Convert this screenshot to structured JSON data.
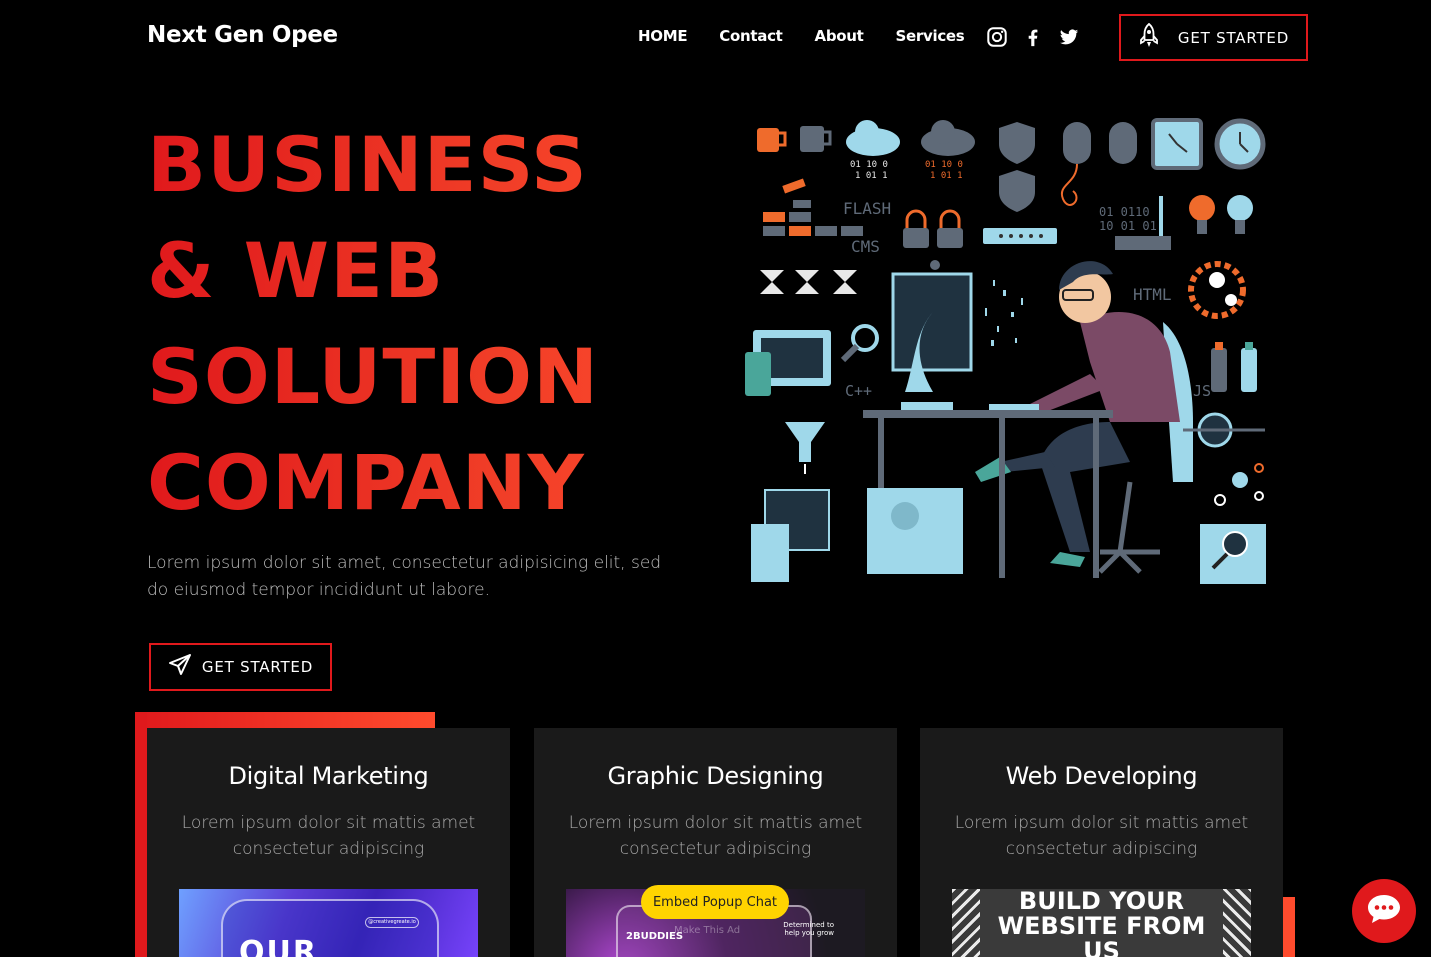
{
  "header": {
    "brand": "Next Gen Opee",
    "nav": [
      "HOME",
      "Contact",
      "About",
      "Services"
    ],
    "socials": [
      "instagram-icon",
      "facebook-icon",
      "twitter-icon"
    ],
    "cta": "GET STARTED"
  },
  "hero": {
    "title_lines": [
      "BUSINESS",
      "& WEB",
      "SOLUTION",
      "COMPANY"
    ],
    "description": "Lorem ipsum dolor sit amet, consectetur adipisicing elit, sed do eiusmod tempor incididunt ut labore.",
    "cta": "GET STARTED",
    "illustration_labels": {
      "flash": "FLASH",
      "cms": "CMS",
      "html": "HTML",
      "cpp": "C++",
      "js": "JS"
    }
  },
  "services": [
    {
      "title": "Digital Marketing",
      "description": "Lorem ipsum dolor sit mattis amet consectetur adipiscing",
      "thumb_text": "OUR",
      "thumb_tag": "@creativegreate.io"
    },
    {
      "title": "Graphic Designing",
      "description": "Lorem ipsum dolor sit mattis amet consectetur adipiscing",
      "thumb_text": "2BUDDIES",
      "thumb_sub": "Determined to help you grow",
      "thumb_faded": "Make This Ad"
    },
    {
      "title": "Web Developing",
      "description": "Lorem ipsum dolor sit mattis amet consectetur adipiscing",
      "thumb_text_1": "BUILD YOUR",
      "thumb_text_2": "WEBSITE FROM",
      "thumb_text_3": "US"
    }
  ],
  "popup": {
    "label": "Embed Popup Chat"
  },
  "colors": {
    "accent": "#e0191c",
    "accent_light": "#ff4b2d",
    "card_bg": "#1a1a1a",
    "pill": "#ffd400"
  }
}
